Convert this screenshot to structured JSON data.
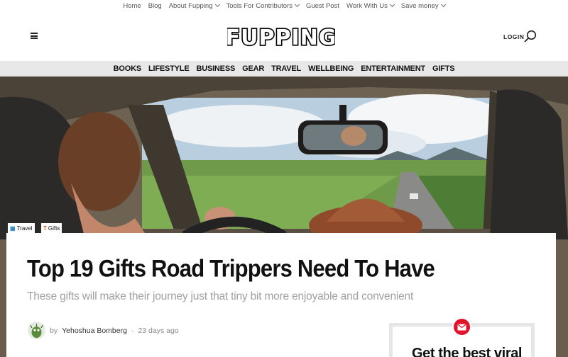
{
  "topnav": {
    "items": [
      {
        "label": "Home",
        "has_dropdown": false
      },
      {
        "label": "Blog",
        "has_dropdown": false
      },
      {
        "label": "About Fupping",
        "has_dropdown": true
      },
      {
        "label": "Tools For Contributors",
        "has_dropdown": true
      },
      {
        "label": "Guest Post",
        "has_dropdown": false
      },
      {
        "label": "Work With Us",
        "has_dropdown": true
      },
      {
        "label": "Save money",
        "has_dropdown": true
      }
    ]
  },
  "header": {
    "logo_text": "FUPPING",
    "login_label": "LOGIN",
    "menu_icon": "hamburger-menu-icon",
    "search_icon": "search-icon"
  },
  "categories": [
    "BOOKS",
    "LIFESTYLE",
    "BUSINESS",
    "GEAR",
    "TRAVEL",
    "WELLBEING",
    "ENTERTAINMENT",
    "GIFTS"
  ],
  "article": {
    "tags": [
      {
        "label": "Travel",
        "icon": "travel-icon",
        "icon_color": "#2e86c1"
      },
      {
        "label": "Gifts",
        "icon": "gift-icon",
        "icon_color": "#e8541a"
      }
    ],
    "title": "Top 19 Gifts Road Trippers Need To Have",
    "subtitle": "These gifts will make their journey just that tiny bit more enjoyable and convenient",
    "byline_prefix": "by",
    "author": "Yehoshua Bomberg",
    "separator": "·",
    "published": "23 days ago"
  },
  "newsletter": {
    "title": "Get the best viral",
    "icon": "mail-icon",
    "accent": "#e2122a"
  }
}
